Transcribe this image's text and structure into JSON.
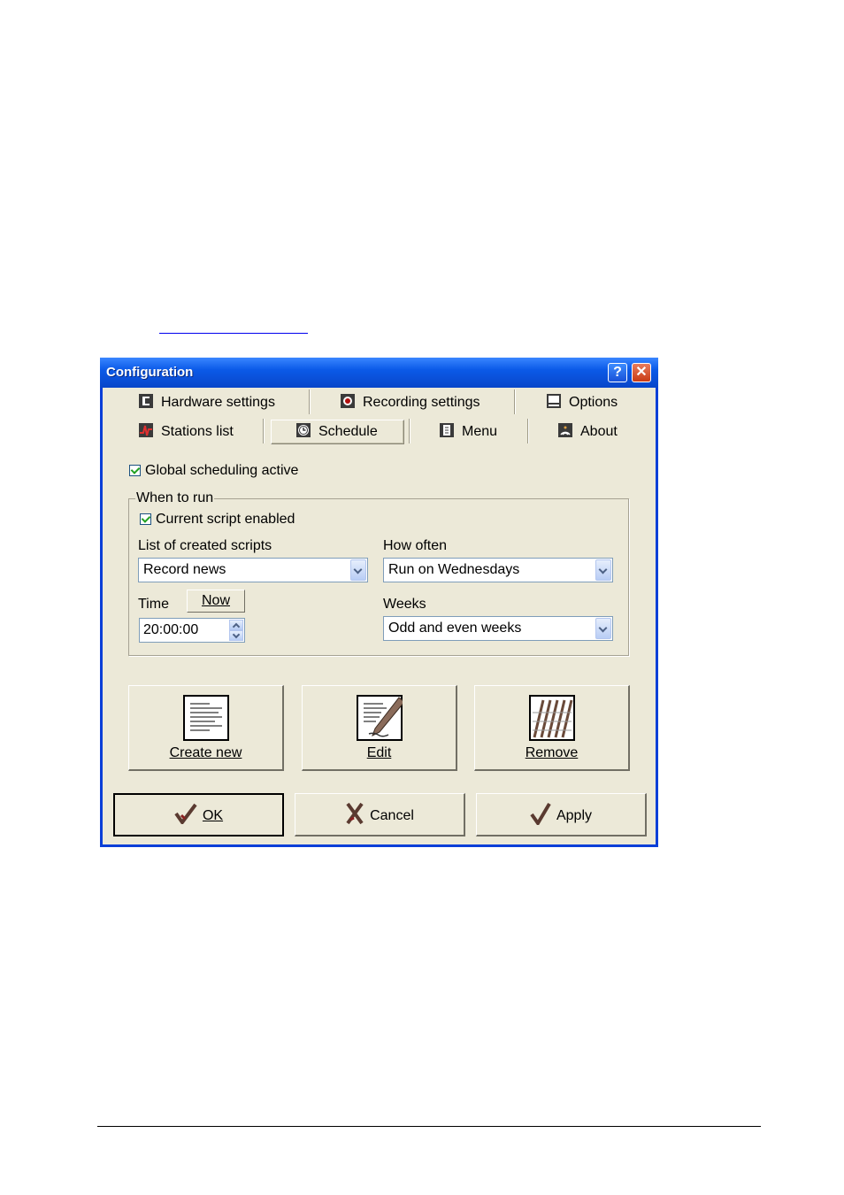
{
  "window": {
    "title": "Configuration"
  },
  "titlebar": {
    "help_glyph": "?",
    "close_glyph": "✕"
  },
  "tabs": [
    {
      "label": "Hardware settings",
      "icon": "hardware-icon"
    },
    {
      "label": "Recording settings",
      "icon": "record-icon"
    },
    {
      "label": "Options",
      "icon": "monitor-icon"
    },
    {
      "label": "Stations list",
      "icon": "stations-icon"
    },
    {
      "label": "Schedule",
      "icon": "clock-icon",
      "active": true
    },
    {
      "label": "Menu",
      "icon": "menu-icon"
    },
    {
      "label": "About",
      "icon": "about-icon"
    }
  ],
  "schedule": {
    "global_active_label": "Global scheduling active",
    "global_active_checked": true,
    "group_title": "When to run",
    "script_enabled_label": "Current script enabled",
    "script_enabled_checked": true,
    "scripts_label": "List of created scripts",
    "scripts_value": "Record news",
    "how_often_label": "How often",
    "how_often_value": "Run on Wednesdays",
    "time_label": "Time",
    "now_button": "Now",
    "time_value": "20:00:00",
    "weeks_label": "Weeks",
    "weeks_value": "Odd and even weeks"
  },
  "actions": {
    "create_label": "Create new",
    "edit_label": "Edit",
    "remove_label": "Remove"
  },
  "dialog_buttons": {
    "ok": "OK",
    "cancel": "Cancel",
    "apply": "Apply"
  }
}
